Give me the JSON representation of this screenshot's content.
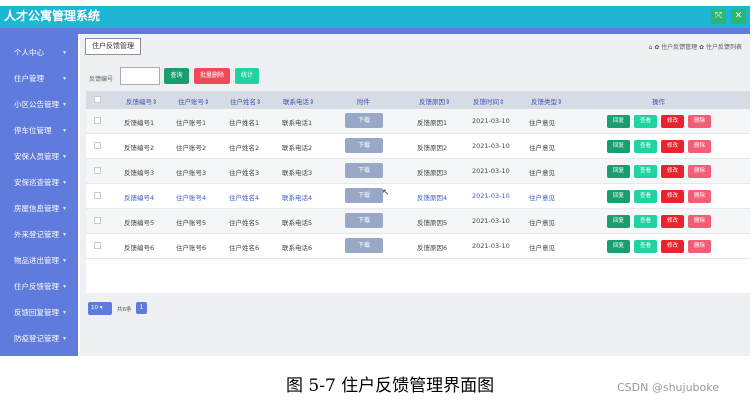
{
  "app": {
    "title": "人才公寓管理系统"
  },
  "window_buttons": [
    {
      "icon": "expand-icon",
      "glyph": "⤧"
    },
    {
      "icon": "close-icon",
      "glyph": "✕"
    }
  ],
  "sidebar": {
    "items": [
      {
        "label": "个人中心",
        "arrow": "▾"
      },
      {
        "label": "住户管理",
        "arrow": "▾"
      },
      {
        "label": "小区公告管理",
        "arrow": "▾"
      },
      {
        "label": "停车位管理",
        "arrow": "▾"
      },
      {
        "label": "安保人员管理",
        "arrow": "▾"
      },
      {
        "label": "安保巡查管理",
        "arrow": "▾"
      },
      {
        "label": "房屋信息管理",
        "arrow": "▾"
      },
      {
        "label": "外来登记管理",
        "arrow": "▾"
      },
      {
        "label": "物品进出管理",
        "arrow": "▾"
      },
      {
        "label": "住户反馈管理",
        "arrow": "▾"
      },
      {
        "label": "反馈回复管理",
        "arrow": "▾"
      },
      {
        "label": "防疫登记管理",
        "arrow": "▾"
      }
    ]
  },
  "header": {
    "page_tab": "住户反馈管理",
    "breadcrumb": "⌂ ✿ 住户反馈管理 ✿ 住户反馈列表"
  },
  "search": {
    "label": "反馈编号",
    "value": "",
    "buttons": {
      "query": "查询",
      "batch_delete": "批量删除",
      "stats": "统计"
    }
  },
  "colors": {
    "query": "#1a9e6e",
    "batch_delete": "#f04a5a",
    "stats": "#20d3a0",
    "title_bar": "#1fb6d6",
    "sidebar": "#5f7bdc"
  },
  "table": {
    "columns": [
      "反馈编号⇕",
      "住户账号⇕",
      "住户姓名⇕",
      "联系电话⇕",
      "附件",
      "反馈原因⇕",
      "反馈时间⇕",
      "反馈类型⇕",
      "操作"
    ],
    "download_label": "下载",
    "actions": {
      "reply": "回复",
      "view": "查看",
      "edit": "修改",
      "delete": "删除"
    },
    "rows": [
      {
        "id": "反馈编号1",
        "account": "住户账号1",
        "name": "住户姓名1",
        "phone": "联系电话1",
        "reason": "反馈原因1",
        "time": "2021-03-10",
        "type": "住户意见"
      },
      {
        "id": "反馈编号2",
        "account": "住户账号2",
        "name": "住户姓名2",
        "phone": "联系电话2",
        "reason": "反馈原因2",
        "time": "2021-03-10",
        "type": "住户意见"
      },
      {
        "id": "反馈编号3",
        "account": "住户账号3",
        "name": "住户姓名3",
        "phone": "联系电话3",
        "reason": "反馈原因3",
        "time": "2021-03-10",
        "type": "住户意见"
      },
      {
        "id": "反馈编号4",
        "account": "住户账号4",
        "name": "住户姓名4",
        "phone": "联系电话4",
        "reason": "反馈原因4",
        "time": "2021-03-10",
        "type": "住户意见"
      },
      {
        "id": "反馈编号5",
        "account": "住户账号5",
        "name": "住户姓名5",
        "phone": "联系电话5",
        "reason": "反馈原因5",
        "time": "2021-03-10",
        "type": "住户意见"
      },
      {
        "id": "反馈编号6",
        "account": "住户账号6",
        "name": "住户姓名6",
        "phone": "联系电话6",
        "reason": "反馈原因6",
        "time": "2021-03-10",
        "type": "住户意见"
      }
    ]
  },
  "pagination": {
    "page_size": "10",
    "total_text": "共6条",
    "current_page": "1"
  },
  "caption": "图 5-7 住户反馈管理界面图",
  "watermark": "CSDN @shujuboke"
}
